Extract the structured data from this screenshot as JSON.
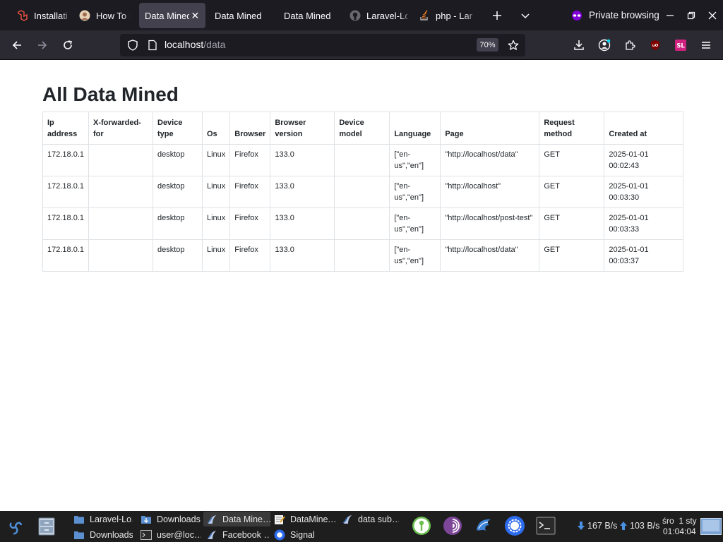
{
  "tabs": [
    {
      "title": "Installation",
      "icon": "laravel-icon",
      "active": false
    },
    {
      "title": "How To In",
      "icon": "avatar-favicon",
      "active": false
    },
    {
      "title": "Data Mined",
      "icon": "",
      "active": true
    },
    {
      "title": "Data Mined",
      "icon": "",
      "active": false
    },
    {
      "title": "Data Mined",
      "icon": "",
      "active": false
    },
    {
      "title": "Laravel-Lo",
      "icon": "github-icon",
      "active": false
    },
    {
      "title": "php - Lara",
      "icon": "stackoverflow-icon",
      "active": false
    }
  ],
  "browser": {
    "private_label": "Private browsing",
    "url_host": "localhost",
    "url_path": "/data",
    "zoom": "70%"
  },
  "page": {
    "title": "All Data Mined",
    "columns": [
      "Ip address",
      "X-forwarded-for",
      "Device type",
      "Os",
      "Browser",
      "Browser version",
      "Device model",
      "Language",
      "Page",
      "Request method",
      "Created at"
    ],
    "rows": [
      [
        "172.18.0.1",
        "",
        "desktop",
        "Linux",
        "Firefox",
        "133.0",
        "",
        "[\"en-us\",\"en\"]",
        "\"http://localhost/data\"",
        "GET",
        "2025-01-01 00:02:43"
      ],
      [
        "172.18.0.1",
        "",
        "desktop",
        "Linux",
        "Firefox",
        "133.0",
        "",
        "[\"en-us\",\"en\"]",
        "\"http://localhost\"",
        "GET",
        "2025-01-01 00:03:30"
      ],
      [
        "172.18.0.1",
        "",
        "desktop",
        "Linux",
        "Firefox",
        "133.0",
        "",
        "[\"en-us\",\"en\"]",
        "\"http://localhost/post-test\"",
        "GET",
        "2025-01-01 00:03:33"
      ],
      [
        "172.18.0.1",
        "",
        "desktop",
        "Linux",
        "Firefox",
        "133.0",
        "",
        "[\"en-us\",\"en\"]",
        "\"http://localhost/data\"",
        "GET",
        "2025-01-01 00:03:37"
      ]
    ]
  },
  "taskbar": {
    "tasks": [
      {
        "label": "Laravel-Lo…",
        "icon": "folder-icon",
        "active": false
      },
      {
        "label": "Downloads",
        "icon": "downloads-folder-icon",
        "active": false
      },
      {
        "label": "Data Mine…",
        "icon": "browser-icon",
        "active": true
      },
      {
        "label": "DataMine.…",
        "icon": "text-editor-icon",
        "active": false
      },
      {
        "label": "data sub…",
        "icon": "browser-icon",
        "active": false
      },
      {
        "label": "Downloads",
        "icon": "folder-icon",
        "active": false
      },
      {
        "label": "user@loc…",
        "icon": "terminal-icon",
        "active": false
      },
      {
        "label": "Facebook …",
        "icon": "browser-icon",
        "active": false
      },
      {
        "label": "Signal",
        "icon": "signal-icon",
        "active": false
      }
    ],
    "download_speed": "167 B/s",
    "upload_speed": "103 B/s",
    "clock_day": "śro  1 sty",
    "clock_time": "01:04:04"
  },
  "colors": {
    "tab_bg": "#1c1b22",
    "toolbar_bg": "#2b2a33",
    "active_tab": "#42414d",
    "private_purple": "#8000d7",
    "taskbar_bg": "#1e1e1e"
  }
}
